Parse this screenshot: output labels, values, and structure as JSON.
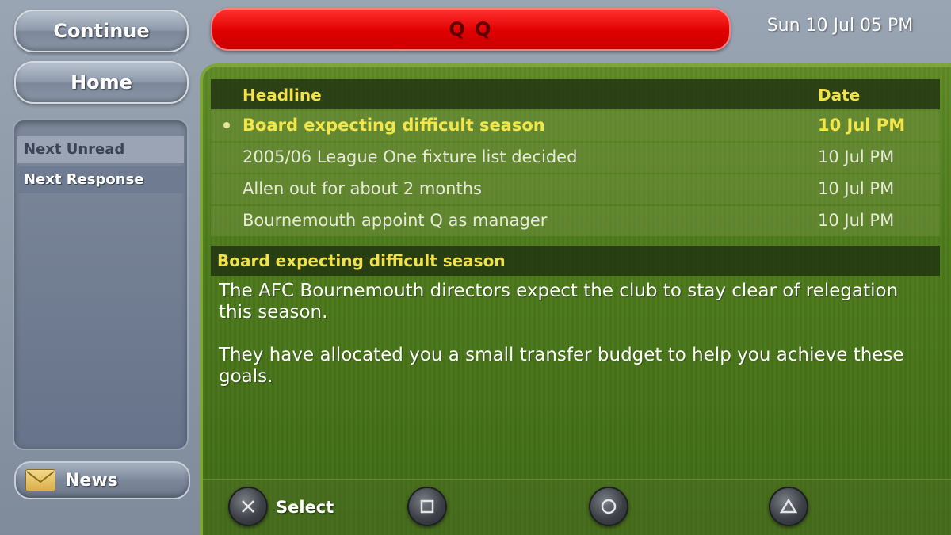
{
  "sidebar": {
    "continue_label": "Continue",
    "home_label": "Home",
    "items": [
      {
        "label": "Next Unread"
      },
      {
        "label": "Next Response"
      }
    ],
    "news_label": "News"
  },
  "header": {
    "title": "Q Q",
    "datetime": "Sun 10 Jul 05 PM"
  },
  "inbox": {
    "columns": {
      "headline": "Headline",
      "date": "Date"
    },
    "rows": [
      {
        "headline": "Board expecting difficult season",
        "date": "10 Jul PM"
      },
      {
        "headline": "2005/06 League One fixture list decided",
        "date": "10 Jul PM"
      },
      {
        "headline": "Allen out for about 2 months",
        "date": "10 Jul PM"
      },
      {
        "headline": "Bournemouth appoint Q as manager",
        "date": "10 Jul PM"
      }
    ],
    "selected_index": 0
  },
  "story": {
    "title": "Board expecting difficult season",
    "paragraphs": [
      "The AFC Bournemouth directors expect the club to stay clear of relegation this season.",
      "They have allocated you a small transfer budget to help you achieve these goals."
    ]
  },
  "controls": {
    "cross_label": "Select",
    "icons": [
      "cross-icon",
      "square-icon",
      "circle-icon",
      "triangle-icon"
    ]
  },
  "colors": {
    "title_bar": "#e00000",
    "headline_yellow": "#f1e24b",
    "pitch_green": "#4d7a1c"
  }
}
